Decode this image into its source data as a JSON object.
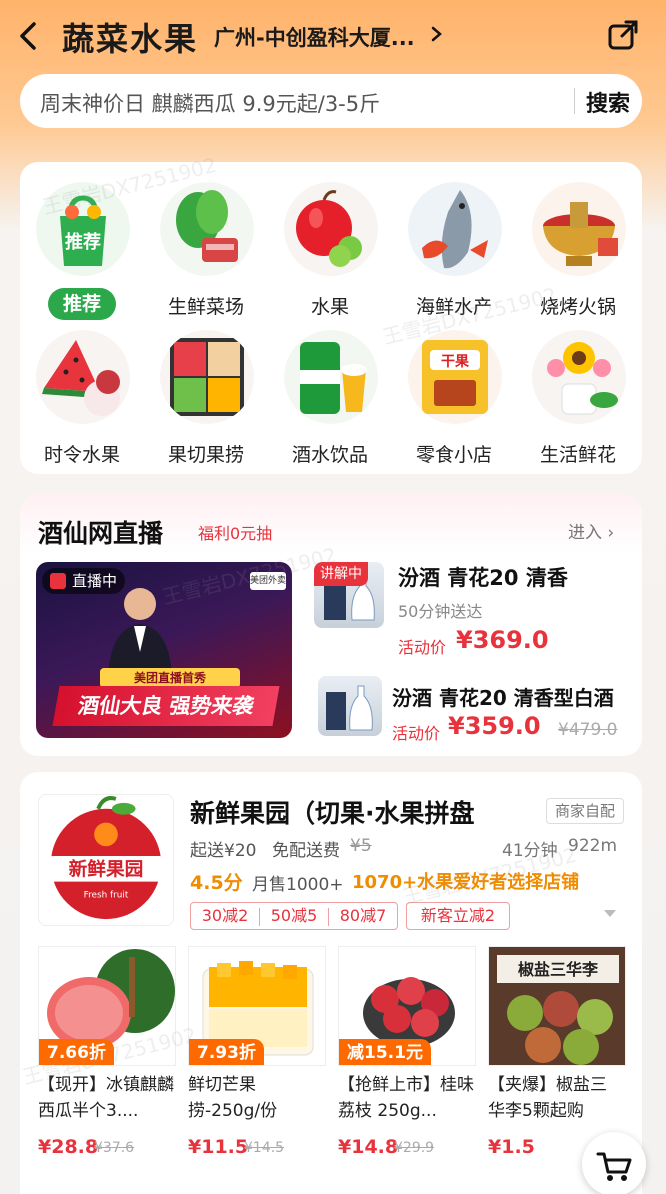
{
  "header": {
    "title": "蔬菜水果",
    "location": "广州-中创盈科大厦..."
  },
  "search": {
    "query": "周末神价日 麒麟西瓜 9.9元起/3-5斤",
    "button": "搜索"
  },
  "categories": [
    {
      "label": "推荐",
      "icon": "shopping-bag-icon",
      "img_label": "推荐"
    },
    {
      "label": "生鲜菜场",
      "icon": "vegetables-icon"
    },
    {
      "label": "水果",
      "icon": "apple-icon"
    },
    {
      "label": "海鲜水产",
      "icon": "seafood-icon"
    },
    {
      "label": "烧烤火锅",
      "icon": "hotpot-icon"
    },
    {
      "label": "时令水果",
      "icon": "watermelon-icon"
    },
    {
      "label": "果切果捞",
      "icon": "fruit-cut-icon"
    },
    {
      "label": "酒水饮品",
      "icon": "beer-icon"
    },
    {
      "label": "零食小店",
      "icon": "snack-icon",
      "img_label": "干果"
    },
    {
      "label": "生活鲜花",
      "icon": "flower-icon"
    }
  ],
  "live": {
    "title": "酒仙网直播",
    "welfare": "福利0元抽",
    "enter": "进入",
    "banner_badge": "直播中",
    "banner_tag": "美团外卖",
    "banner_sub": "美团直播首秀",
    "banner_caption": "酒仙大良 强势来袭",
    "items": [
      {
        "tag": "讲解中",
        "name": "汾酒 青花20 清香",
        "eta": "50分钟送达",
        "price_label": "活动价",
        "price": "¥369.0",
        "old_price": ""
      },
      {
        "tag": "",
        "name": "汾酒 青花20 清香型白酒",
        "eta": "",
        "price_label": "活动价",
        "price": "¥359.0",
        "old_price": "¥479.0"
      }
    ]
  },
  "store": {
    "name": "新鲜果园（切果·水果拼盘",
    "self_delivery": "商家自配",
    "min_order": "起送¥20",
    "free_delivery": "免配送费",
    "old_fee": "¥5",
    "time": "41分钟",
    "distance": "922m",
    "rating": "4.5分",
    "monthly_sales": "月售1000+",
    "fans": "1070+水果爱好者选择店铺",
    "logo_text": "新鲜果园",
    "logo_sub": "Fresh fruit",
    "coupons": [
      "30减2",
      "50减5",
      "80减7"
    ],
    "new_customer": "新客立减2",
    "products": [
      {
        "discount": "7.66折",
        "name": "【现开】冰镇麒麟西瓜半个3....",
        "price": "¥28.8",
        "old_price": "¥37.6"
      },
      {
        "discount": "7.93折",
        "name": "鲜切芒果捞-250g/份",
        "price": "¥11.5",
        "old_price": "¥14.5"
      },
      {
        "discount": "减15.1元",
        "name": "【抢鲜上市】桂味荔枝 250g...",
        "price": "¥14.8",
        "old_price": "¥29.9"
      },
      {
        "discount": "",
        "name": "【夹爆】椒盐三华李5颗起购",
        "price": "¥1.5",
        "old_price": "",
        "img_label": "椒盐三华李"
      }
    ]
  },
  "watermark": "王雪岩DX7251902"
}
